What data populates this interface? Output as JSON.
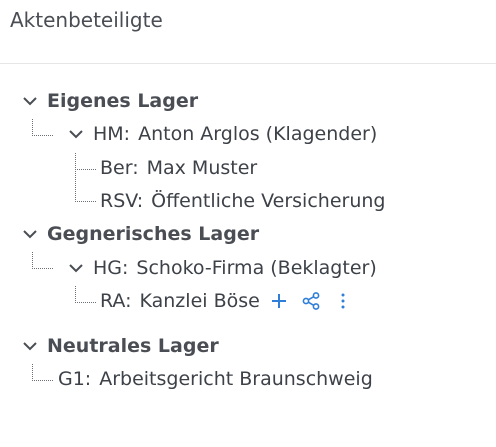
{
  "panel": {
    "title": "Aktenbeteiligte"
  },
  "colors": {
    "action_blue": "#2f7ed8",
    "text": "#3d4148",
    "connector": "#6b6f75"
  },
  "tree": {
    "own": {
      "label": "Eigenes Lager",
      "hm": {
        "role": "HM:",
        "name": "Anton Arglos (Klagender)"
      },
      "ber": {
        "role": "Ber:",
        "name": "Max Muster"
      },
      "rsv": {
        "role": "RSV:",
        "name": "Öffentliche Versicherung"
      }
    },
    "opposing": {
      "label": "Gegnerisches Lager",
      "hg": {
        "role": "HG:",
        "name": "Schoko-Firma (Beklagter)"
      },
      "ra": {
        "role": "RA:",
        "name": "Kanzlei Böse"
      }
    },
    "neutral": {
      "label": "Neutrales Lager",
      "g1": {
        "role": "G1:",
        "name": "Arbeitsgericht Braunschweig"
      }
    }
  },
  "icons": {
    "expand": "chevron-down-icon",
    "add": "plus-icon",
    "share": "share-icon",
    "more": "more-vertical-icon"
  }
}
